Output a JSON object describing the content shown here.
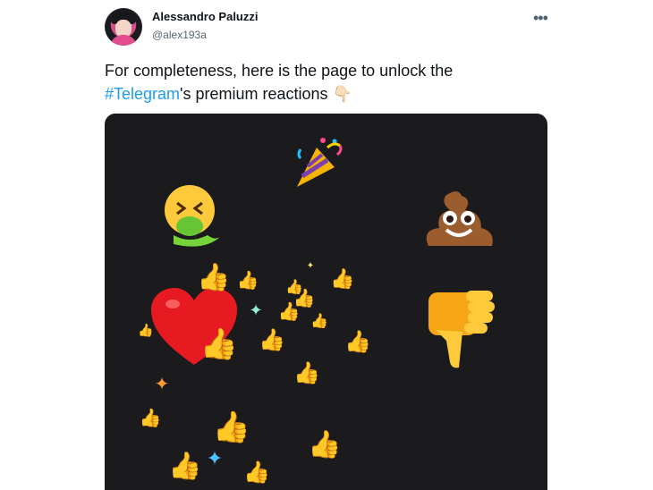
{
  "author": {
    "name": "Alessandro Paluzzi",
    "handle": "@alex193a"
  },
  "header": {
    "more_icon": "more-horizontal-icon"
  },
  "tweet": {
    "text_before": "For completeness, here is the page to unlock the",
    "hashtag": "#Telegram",
    "text_after": "'s premium reactions",
    "emoji": "👇🏻"
  },
  "media": {
    "alt": "Telegram premium reactions animation",
    "background": "#1b1b1d",
    "reactions": [
      "party-popper",
      "nauseated-face",
      "pile-of-poo",
      "red-heart",
      "thumbs-down",
      "thumbs-up",
      "sparkles"
    ]
  }
}
